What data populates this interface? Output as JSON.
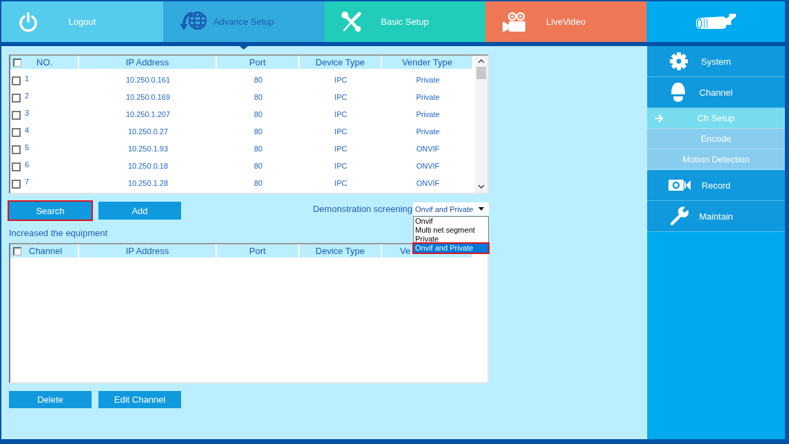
{
  "tabs": [
    {
      "label": "Logout",
      "selected": false
    },
    {
      "label": "Advance Setup",
      "selected": true
    },
    {
      "label": "Basic Setup",
      "selected": false
    },
    {
      "label": "LiveVideo",
      "selected": false
    }
  ],
  "device_table": {
    "header_checked": false,
    "columns": [
      "NO.",
      "IP Address",
      "Port",
      "Device Type",
      "Vender Type"
    ],
    "rows": [
      {
        "checked": false,
        "cells": [
          "1",
          "10.250.0.161",
          "80",
          "IPC",
          "Private"
        ]
      },
      {
        "checked": false,
        "cells": [
          "2",
          "10.250.0.169",
          "80",
          "IPC",
          "Private"
        ]
      },
      {
        "checked": false,
        "cells": [
          "3",
          "10.250.1.207",
          "80",
          "IPC",
          "Private"
        ]
      },
      {
        "checked": false,
        "cells": [
          "4",
          "10.250.0.27",
          "80",
          "IPC",
          "Private"
        ]
      },
      {
        "checked": false,
        "cells": [
          "5",
          "10.250.1.93",
          "80",
          "IPC",
          "ONVIF"
        ]
      },
      {
        "checked": false,
        "cells": [
          "6",
          "10.250.0.18",
          "80",
          "IPC",
          "ONVIF"
        ]
      },
      {
        "checked": false,
        "cells": [
          "7",
          "10.250.1.28",
          "80",
          "IPC",
          "ONVIF"
        ]
      }
    ]
  },
  "search_actions": [
    {
      "label": "Search",
      "highlighted": true
    },
    {
      "label": "Add",
      "highlighted": false
    }
  ],
  "filter": {
    "label": "Demonstration screening",
    "value": "Onvif and Private",
    "expanded": true,
    "options": [
      {
        "label": "Onvif",
        "selected": false,
        "highlighted": false
      },
      {
        "label": "Multi net segment",
        "selected": false,
        "highlighted": false
      },
      {
        "label": "Private",
        "selected": false,
        "highlighted": false
      },
      {
        "label": "Onvif and Private",
        "selected": true,
        "highlighted": true
      }
    ]
  },
  "added_table": {
    "title": "Increased the equipment",
    "header_checked": false,
    "columns": [
      "Channel",
      "IP Address",
      "Port",
      "Device Type",
      "Ve"
    ]
  },
  "bottom_actions": [
    {
      "label": "Delete",
      "highlighted": false
    },
    {
      "label": "Edit Channel",
      "highlighted": false
    }
  ],
  "sidebar": {
    "items": [
      {
        "label": "System",
        "selected": false
      },
      {
        "label": "Channel",
        "selected": false,
        "children": [
          {
            "label": "Ch Setup",
            "selected": true
          },
          {
            "label": "Encode",
            "selected": false
          },
          {
            "label": "Motion Detection",
            "selected": false
          }
        ]
      },
      {
        "label": "Record",
        "selected": false
      },
      {
        "label": "Maintain",
        "selected": false
      }
    ]
  }
}
